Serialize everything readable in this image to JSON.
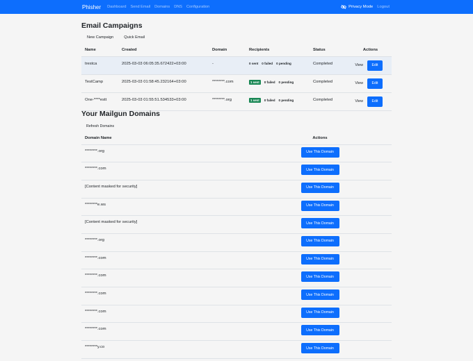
{
  "navbar": {
    "brand": "Phisher",
    "links": [
      "Dashboard",
      "Send Email",
      "Domains",
      "DNS",
      "Configuration"
    ],
    "privacy_label": "Privacy Mode",
    "logout_label": "Logout"
  },
  "campaigns": {
    "title": "Email Campaigns",
    "buttons": [
      "New Campaign",
      "Quick Email"
    ],
    "columns": [
      "Name",
      "Created",
      "Domain",
      "Recipients",
      "Status",
      "Actions"
    ],
    "rows": [
      {
        "name": "trestca",
        "created": "2025-03-03 06:05:35.672422+03:00",
        "domain": "-",
        "sent": "0 sent",
        "sent_highlight": false,
        "failed": "0 failed",
        "pending": "0 pending",
        "status": "Completed",
        "view": "View",
        "edit": "Edit"
      },
      {
        "name": "TestCamp",
        "created": "2025-03-03 01:58:45.232164+03:00",
        "domain": "********.com",
        "sent": "1 sent",
        "sent_highlight": true,
        "failed": "0 failed",
        "pending": "0 pending",
        "status": "Completed",
        "view": "View",
        "edit": "Edit"
      },
      {
        "name": "One-****estt",
        "created": "2025-03-03 01:55:51.534533+03:00",
        "domain": "********.org",
        "sent": "1 sent",
        "sent_highlight": true,
        "failed": "0 failed",
        "pending": "0 pending",
        "status": "Completed",
        "view": "View",
        "edit": "Edit"
      }
    ]
  },
  "domains": {
    "title": "Your Mailgun Domains",
    "refresh_label": "Refresh Domains",
    "columns": [
      "Domain Name",
      "Actions"
    ],
    "use_label": "Use This Domain",
    "rows": [
      "********.org",
      "********.com",
      "[Content masked for security]",
      "********e.ws",
      "[Content masked for security]",
      "********.org",
      "********.com",
      "********.com",
      "********.com",
      "********.com",
      "********.com",
      "********y.co"
    ]
  },
  "colors": {
    "primary": "#0d6efd",
    "success": "#198754",
    "highlight_row": "#e8eef6"
  }
}
